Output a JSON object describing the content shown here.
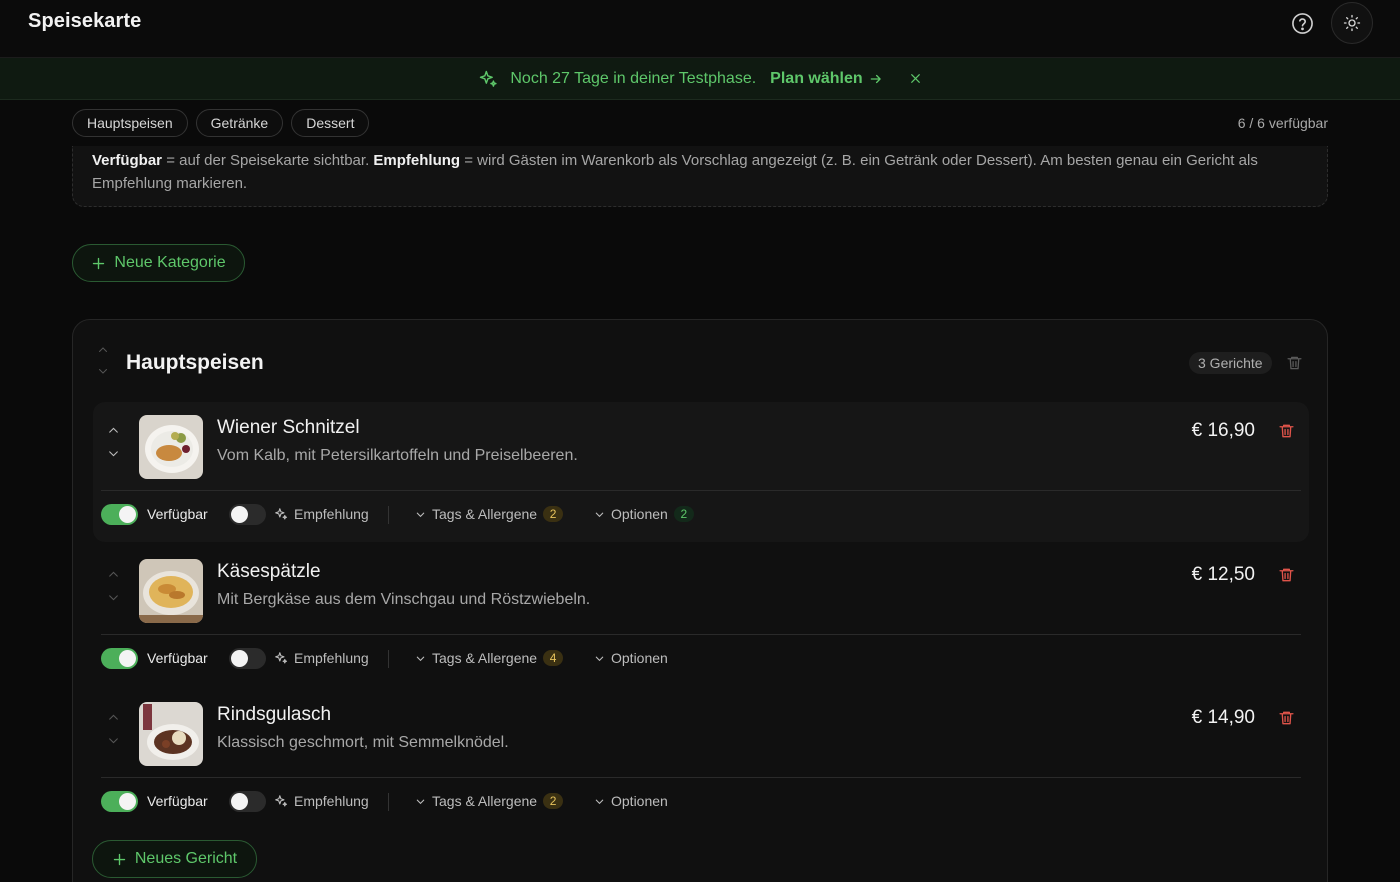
{
  "header": {
    "title": "Speisekarte",
    "help_icon": "question-circle-icon",
    "theme_icon": "sun-icon"
  },
  "banner": {
    "text": "Noch 27 Tage in deiner Testphase.",
    "link": "Plan wählen",
    "color": "#5ec76a"
  },
  "category_pills": [
    "Hauptspeisen",
    "Getränke",
    "Dessert"
  ],
  "availability_summary": "6 / 6 verfügbar",
  "info": {
    "term1": "Verfügbar",
    "text1": " = auf der Speisekarte sichtbar. ",
    "term2": "Empfehlung",
    "text2": " = wird Gästen im Warenkorb als Vorschlag angezeigt (z. B. ein Getränk oder Dessert). Am besten genau ein Gericht als Empfehlung markieren."
  },
  "new_category_label": "Neue Kategorie",
  "category": {
    "title": "Hauptspeisen",
    "count_label": "3 Gerichte",
    "dishes": [
      {
        "name": "Wiener Schnitzel",
        "description": "Vom Kalb, mit Petersilkartoffeln und Preiselbeeren.",
        "price": "€ 16,90",
        "available_label": "Verfügbar",
        "available": true,
        "recommend_label": "Empfehlung",
        "recommended": false,
        "tags_label": "Tags & Allergene",
        "tags_count": "2",
        "options_label": "Optionen",
        "options_count": "2"
      },
      {
        "name": "Käsespätzle",
        "description": "Mit Bergkäse aus dem Vinschgau und Röstzwiebeln.",
        "price": "€ 12,50",
        "available_label": "Verfügbar",
        "available": true,
        "recommend_label": "Empfehlung",
        "recommended": false,
        "tags_label": "Tags & Allergene",
        "tags_count": "4",
        "options_label": "Optionen",
        "options_count": ""
      },
      {
        "name": "Rindsgulasch",
        "description": "Klassisch geschmort, mit Semmelknödel.",
        "price": "€ 14,90",
        "available_label": "Verfügbar",
        "available": true,
        "recommend_label": "Empfehlung",
        "recommended": false,
        "tags_label": "Tags & Allergene",
        "tags_count": "2",
        "options_label": "Optionen",
        "options_count": ""
      }
    ]
  },
  "new_dish_label": "Neues Gericht",
  "colors": {
    "accent": "#5ec76a",
    "danger": "#e0544a",
    "background": "#0a0a0a"
  }
}
